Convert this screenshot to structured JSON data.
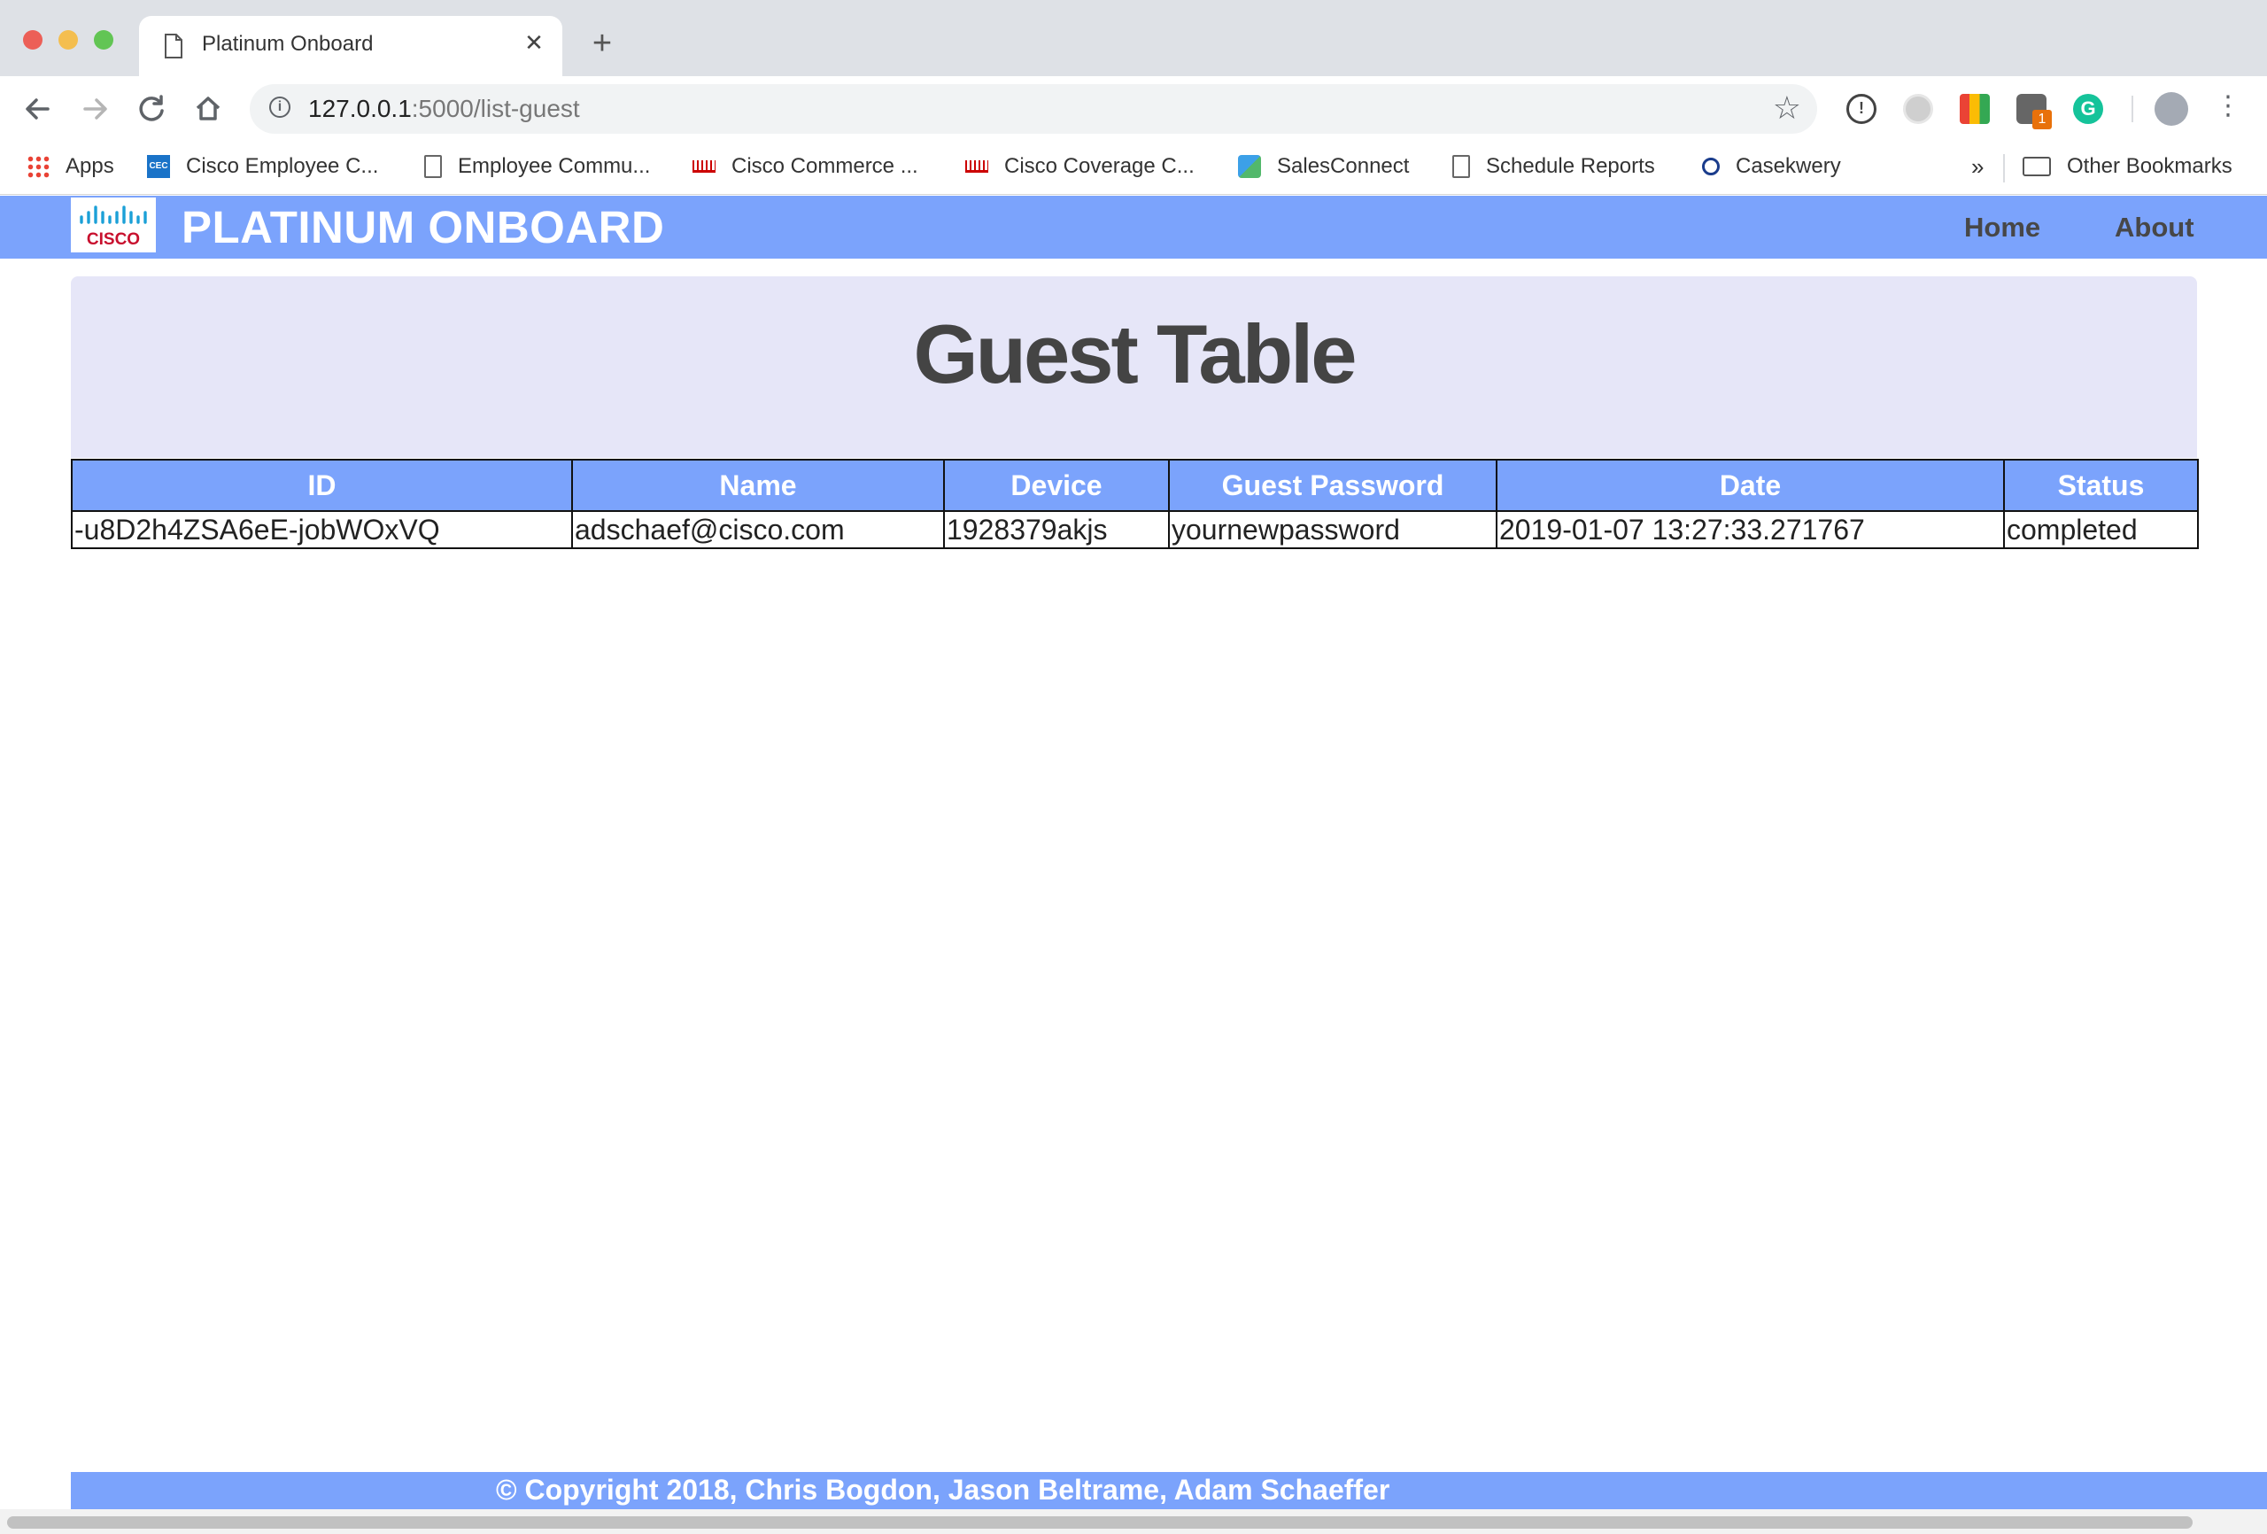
{
  "browser": {
    "tab_title": "Platinum Onboard",
    "tab_close": "✕",
    "new_tab": "+",
    "url_host": "127.0.0.1",
    "url_rest": ":5000/list-guest",
    "bookmarks": [
      {
        "label": "Apps",
        "icon": "apps-grid-icon"
      },
      {
        "label": "Cisco Employee C...",
        "icon": "cec-icon"
      },
      {
        "label": "Employee Commu...",
        "icon": "page-icon"
      },
      {
        "label": "Cisco Commerce ...",
        "icon": "cisco-icon"
      },
      {
        "label": "Cisco Coverage C...",
        "icon": "cisco-icon"
      },
      {
        "label": "SalesConnect",
        "icon": "salesconnect-icon"
      },
      {
        "label": "Schedule Reports",
        "icon": "page-icon"
      },
      {
        "label": "Casekwery",
        "icon": "search-icon"
      }
    ],
    "overflow": "»",
    "other_bookmarks": "Other Bookmarks",
    "extension_badge": "1"
  },
  "nav": {
    "logo_text": "CISCO",
    "brand": "PLATINUM ONBOARD",
    "links": [
      "Home",
      "About"
    ],
    "brand_color": "#7ba3fc"
  },
  "page": {
    "heading": "Guest Table"
  },
  "table": {
    "headers": [
      "ID",
      "Name",
      "Device",
      "Guest Password",
      "Date",
      "Status"
    ],
    "rows": [
      [
        "-u8D2h4ZSA6eE-jobWOxVQ",
        "adschaef@cisco.com",
        "1928379akjs",
        "yournewpassword",
        "2019-01-07 13:27:33.271767",
        "completed"
      ]
    ]
  },
  "footer": {
    "text": "© Copyright 2018, Chris Bogdon, Jason Beltrame, Adam Schaeffer"
  }
}
